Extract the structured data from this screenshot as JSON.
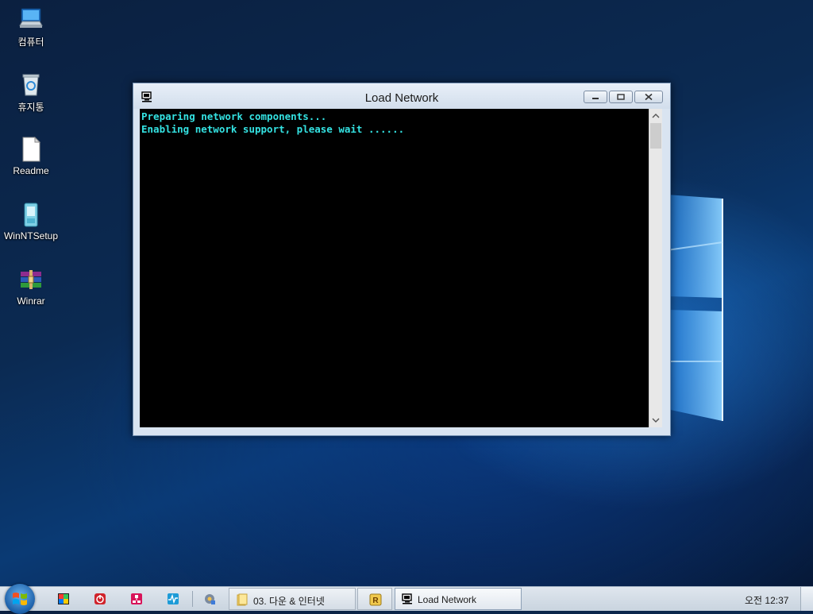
{
  "desktop": {
    "icons": [
      {
        "label": "컴퓨터",
        "icon": "computer-icon"
      },
      {
        "label": "휴지통",
        "icon": "recycle-bin-icon"
      },
      {
        "label": "Readme",
        "icon": "document-icon"
      },
      {
        "label": "WinNTSetup",
        "icon": "winntsetup-icon"
      },
      {
        "label": "Winrar",
        "icon": "winrar-icon"
      }
    ]
  },
  "window": {
    "title": "Load Network",
    "icon": "network-console-icon",
    "console_lines": [
      "Preparing network components...",
      "Enabling network support, please wait ......"
    ],
    "text_color": "#34e2e2"
  },
  "taskbar": {
    "quick_launch": [
      "color-palette-icon",
      "power-icon",
      "network-app-icon",
      "monitor-icon",
      "settings-tools-icon"
    ],
    "tasks": [
      {
        "label": "03. 다운 & 인터넷",
        "icon": "folder-icon"
      },
      {
        "label": "",
        "icon": "winrar-r-icon"
      },
      {
        "label": "Load Network",
        "icon": "network-console-icon"
      }
    ],
    "clock": "오전 12:37"
  }
}
